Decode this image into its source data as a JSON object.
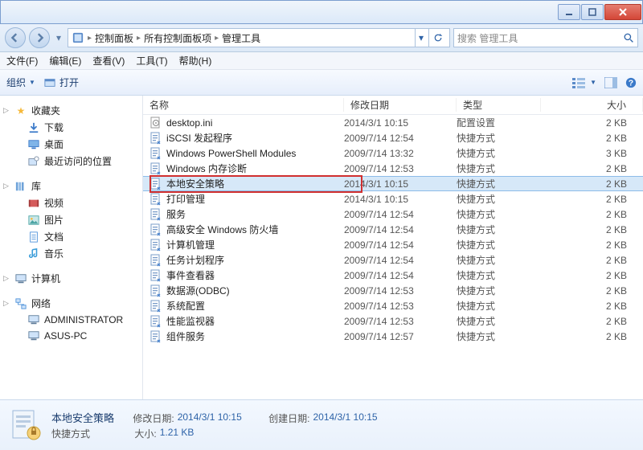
{
  "breadcrumbs": [
    "控制面板",
    "所有控制面板项",
    "管理工具"
  ],
  "search": {
    "placeholder": "搜索 管理工具"
  },
  "menus": [
    "文件(F)",
    "编辑(E)",
    "查看(V)",
    "工具(T)",
    "帮助(H)"
  ],
  "toolbar": {
    "organize": "组织",
    "open": "打开"
  },
  "sidebar": {
    "favorites": {
      "label": "收藏夹",
      "items": [
        "下载",
        "桌面",
        "最近访问的位置"
      ]
    },
    "libraries": {
      "label": "库",
      "items": [
        "视频",
        "图片",
        "文档",
        "音乐"
      ]
    },
    "computer": {
      "label": "计算机"
    },
    "network": {
      "label": "网络",
      "items": [
        "ADMINISTRATOR",
        "ASUS-PC"
      ]
    }
  },
  "columns": {
    "name": "名称",
    "date": "修改日期",
    "type": "类型",
    "size": "大小"
  },
  "files": [
    {
      "name": "desktop.ini",
      "date": "2014/3/1 10:15",
      "type": "配置设置",
      "size": "2 KB"
    },
    {
      "name": "iSCSI 发起程序",
      "date": "2009/7/14 12:54",
      "type": "快捷方式",
      "size": "2 KB"
    },
    {
      "name": "Windows PowerShell Modules",
      "date": "2009/7/14 13:32",
      "type": "快捷方式",
      "size": "3 KB"
    },
    {
      "name": "Windows 内存诊断",
      "date": "2009/7/14 12:53",
      "type": "快捷方式",
      "size": "2 KB"
    },
    {
      "name": "本地安全策略",
      "date": "2014/3/1 10:15",
      "type": "快捷方式",
      "size": "2 KB",
      "selected": true,
      "highlight": true
    },
    {
      "name": "打印管理",
      "date": "2014/3/1 10:15",
      "type": "快捷方式",
      "size": "2 KB"
    },
    {
      "name": "服务",
      "date": "2009/7/14 12:54",
      "type": "快捷方式",
      "size": "2 KB"
    },
    {
      "name": "高级安全 Windows 防火墙",
      "date": "2009/7/14 12:54",
      "type": "快捷方式",
      "size": "2 KB"
    },
    {
      "name": "计算机管理",
      "date": "2009/7/14 12:54",
      "type": "快捷方式",
      "size": "2 KB"
    },
    {
      "name": "任务计划程序",
      "date": "2009/7/14 12:54",
      "type": "快捷方式",
      "size": "2 KB"
    },
    {
      "name": "事件查看器",
      "date": "2009/7/14 12:54",
      "type": "快捷方式",
      "size": "2 KB"
    },
    {
      "name": "数据源(ODBC)",
      "date": "2009/7/14 12:53",
      "type": "快捷方式",
      "size": "2 KB"
    },
    {
      "name": "系统配置",
      "date": "2009/7/14 12:53",
      "type": "快捷方式",
      "size": "2 KB"
    },
    {
      "name": "性能监视器",
      "date": "2009/7/14 12:53",
      "type": "快捷方式",
      "size": "2 KB"
    },
    {
      "name": "组件服务",
      "date": "2009/7/14 12:57",
      "type": "快捷方式",
      "size": "2 KB"
    }
  ],
  "status": {
    "title": "本地安全策略",
    "subtitle": "快捷方式",
    "modLabel": "修改日期:",
    "modVal": "2014/3/1 10:15",
    "sizeLabel": "大小:",
    "sizeVal": "1.21 KB",
    "createLabel": "创建日期:",
    "createVal": "2014/3/1 10:15"
  }
}
